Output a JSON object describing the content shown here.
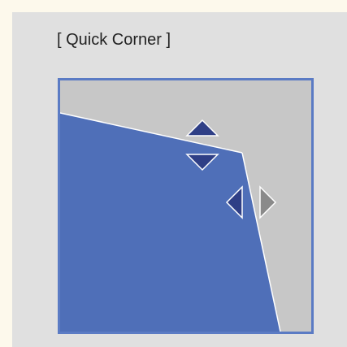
{
  "screen": {
    "title": "[ Quick Corner ]"
  },
  "colors": {
    "page_background": "#fdf9ec",
    "panel_background": "#e0e0e0",
    "preview_border": "#5b7bc4",
    "corrected_area": "#4f6fb8",
    "uncorrected_area": "#c7c7c7",
    "arrow_active": "#2f3f86",
    "arrow_inactive": "#8a8a8a"
  },
  "controls": {
    "up": {
      "icon": "triangle-up-icon",
      "state": "active"
    },
    "down": {
      "icon": "triangle-down-icon",
      "state": "active"
    },
    "left": {
      "icon": "triangle-left-icon",
      "state": "active"
    },
    "right": {
      "icon": "triangle-right-icon",
      "state": "inactive"
    }
  }
}
